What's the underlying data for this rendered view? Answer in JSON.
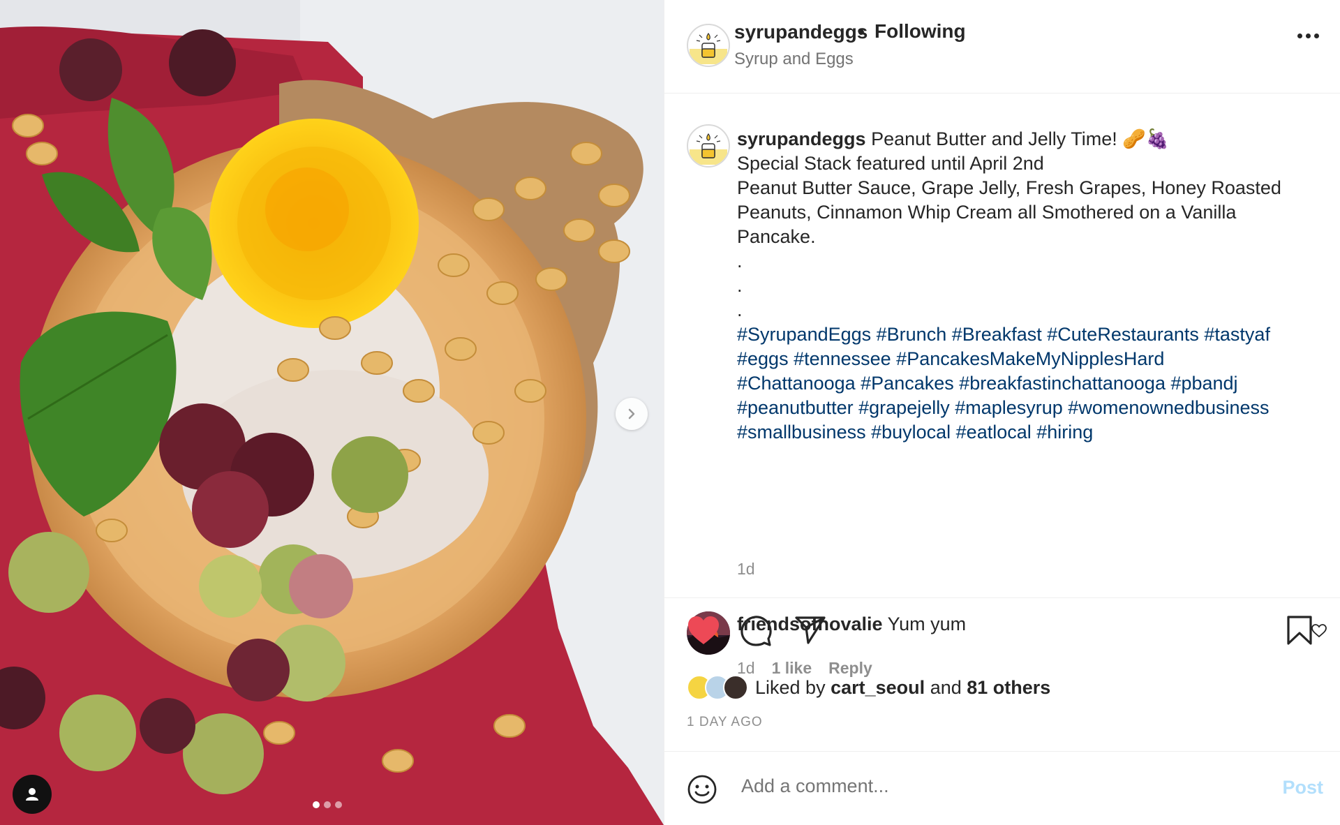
{
  "header": {
    "username": "syrupandeggs",
    "separator": "•",
    "follow_state": "Following",
    "subtitle": "Syrup and Eggs",
    "more_icon": "more-horizontal-icon"
  },
  "post": {
    "caption_username": "syrupandeggs",
    "caption_lines": [
      "Peanut Butter and Jelly Time! 🥜🍇",
      "Special Stack featured until April 2nd",
      "Peanut Butter Sauce, Grape Jelly, Fresh Grapes, Honey Roasted",
      "Peanuts, Cinnamon Whip Cream all Smothered on a Vanilla",
      "Pancake.",
      ".",
      ".",
      "."
    ],
    "hashtag_lines": [
      "#SyrupandEggs #Brunch #Breakfast #CuteRestaurants #tastyaf",
      "#eggs #tennessee #PancakesMakeMyNipplesHard",
      "#Chattanooga #Pancakes #breakfastinchattanooga #pbandj",
      "#peanutbutter #grapejelly #maplesyrup #womenownedbusiness",
      "#smallbusiness #buylocal #eatlocal #hiring"
    ],
    "time": "1d"
  },
  "comment": {
    "username": "friendsofnovalie",
    "text": "Yum yum",
    "time": "1d",
    "likes": "1 like",
    "reply": "Reply"
  },
  "likes": {
    "prefix": "Liked by",
    "user": "cart_seoul",
    "conjunction": "and",
    "others": "81 others",
    "date": "1 DAY AGO"
  },
  "compose": {
    "placeholder": "Add a comment...",
    "post_label": "Post"
  },
  "carousel": {
    "current": 1,
    "total": 3
  },
  "colors": {
    "like_red": "#ed4956",
    "hashtag_blue": "#00376b",
    "post_disabled": "#b2dffc",
    "jelly": "#b5263f"
  }
}
